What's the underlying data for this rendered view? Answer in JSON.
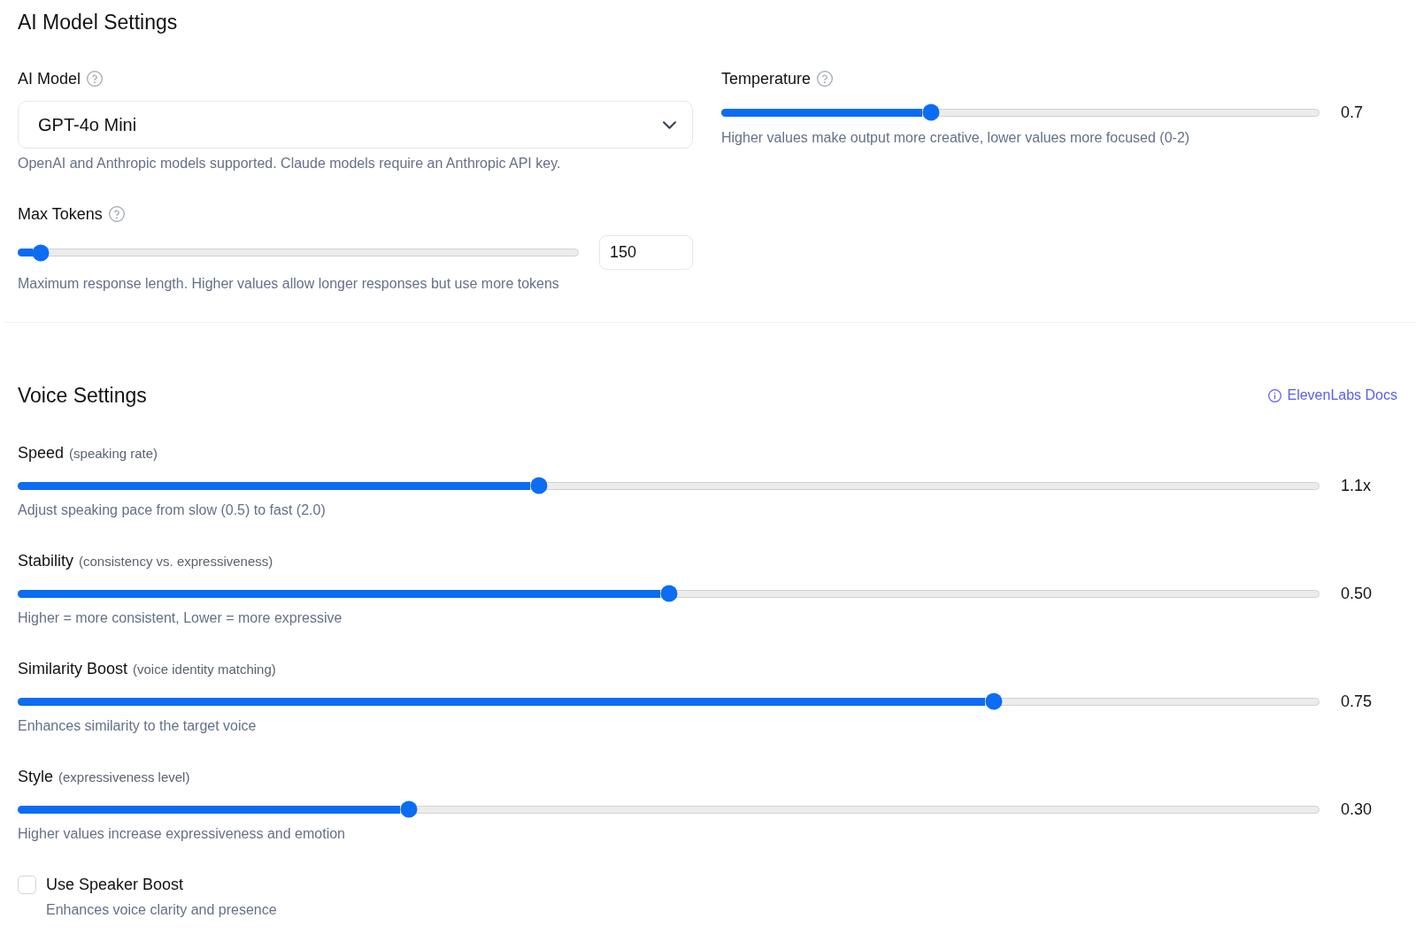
{
  "ai_model_settings": {
    "title": "AI Model Settings",
    "ai_model": {
      "label": "AI Model",
      "value": "GPT-4o Mini",
      "help": "OpenAI and Anthropic models supported. Claude models require an Anthropic API key."
    },
    "temperature": {
      "label": "Temperature",
      "level": 0.35,
      "reading": "0.7",
      "help": "Higher values make output more creative, lower values more focused (0-2)"
    },
    "max_tokens": {
      "label": "Max Tokens",
      "level": 0.04,
      "value": "150",
      "help": "Maximum response length. Higher values allow longer responses but use more tokens"
    }
  },
  "voice_settings": {
    "title": "Voice Settings",
    "docs_link": "ElevenLabs Docs",
    "sliders": [
      {
        "label": "Speed",
        "hint": "(speaking rate)",
        "level": 0.4,
        "reading": "1.1x",
        "help": "Adjust speaking pace from slow (0.5) to fast (2.0)"
      },
      {
        "label": "Stability",
        "hint": "(consistency vs. expressiveness)",
        "level": 0.5,
        "reading": "0.50",
        "help": "Higher = more consistent, Lower = more expressive"
      },
      {
        "label": "Similarity Boost",
        "hint": "(voice identity matching)",
        "level": 0.75,
        "reading": "0.75",
        "help": "Enhances similarity to the target voice"
      },
      {
        "label": "Style",
        "hint": "(expressiveness level)",
        "level": 0.3,
        "reading": "0.30",
        "help": "Higher values increase expressiveness and emotion"
      }
    ],
    "speaker_boost": {
      "label": "Use Speaker Boost",
      "checked": false,
      "help": "Enhances voice clarity and presence"
    }
  }
}
